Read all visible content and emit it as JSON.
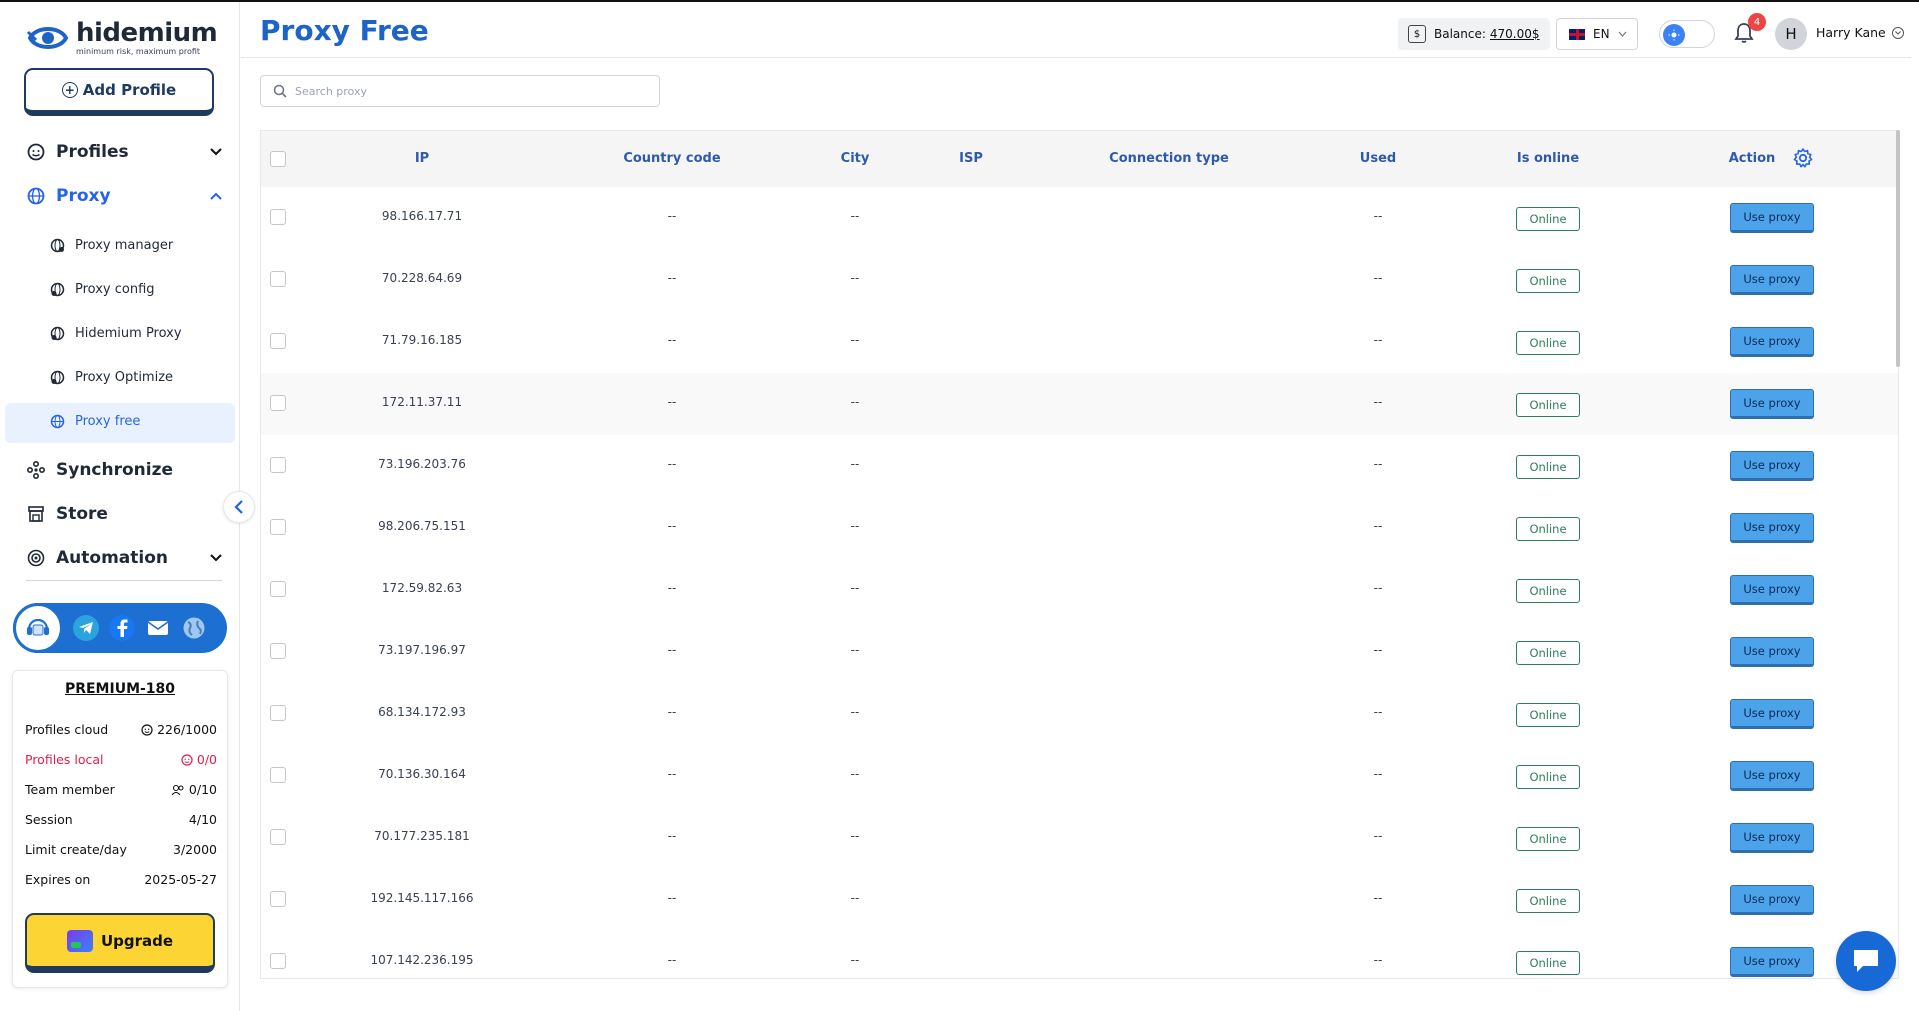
{
  "app": {
    "logo_name": "hidemium",
    "logo_tagline": "minimum risk, maximum profit"
  },
  "sidebar": {
    "add_profile_label": "Add Profile",
    "items": [
      {
        "label": "Profiles",
        "icon": "profiles-icon"
      },
      {
        "label": "Proxy",
        "icon": "globe-icon"
      },
      {
        "label": "Synchronize",
        "icon": "sync-icon"
      },
      {
        "label": "Store",
        "icon": "store-icon"
      },
      {
        "label": "Automation",
        "icon": "automation-icon"
      }
    ],
    "proxy_subitems": [
      {
        "label": "Proxy manager"
      },
      {
        "label": "Proxy config"
      },
      {
        "label": "Hidemium Proxy"
      },
      {
        "label": "Proxy Optimize"
      },
      {
        "label": "Proxy free"
      }
    ],
    "social_icons": [
      "support-agent-icon",
      "telegram-icon",
      "facebook-icon",
      "mail-icon",
      "globe-icon"
    ]
  },
  "plan": {
    "name": "PREMIUM-180",
    "rows": [
      {
        "label": "Profiles cloud",
        "value": "226/1000"
      },
      {
        "label": "Profiles local",
        "value": "0/0"
      },
      {
        "label": "Team member",
        "value": "0/10"
      },
      {
        "label": "Session",
        "value": "4/10"
      },
      {
        "label": "Limit create/day",
        "value": "3/2000"
      },
      {
        "label": "Expires on",
        "value": "2025-05-27"
      }
    ],
    "upgrade_label": "Upgrade"
  },
  "header": {
    "title": "Proxy Free",
    "balance_label": "Balance:",
    "balance_value": "470.00$",
    "language": "EN",
    "notification_count": "4",
    "avatar_initial": "H",
    "user_name": "Harry Kane"
  },
  "search": {
    "placeholder": "Search proxy",
    "value": ""
  },
  "table": {
    "columns": [
      "IP",
      "Country code",
      "City",
      "ISP",
      "Connection type",
      "Used",
      "Is online",
      "Action"
    ],
    "rows": [
      {
        "ip": "98.166.17.71",
        "country": "--",
        "city": "--",
        "used": "--",
        "status": "Online",
        "action": "Use proxy"
      },
      {
        "ip": "70.228.64.69",
        "country": "--",
        "city": "--",
        "used": "--",
        "status": "Online",
        "action": "Use proxy"
      },
      {
        "ip": "71.79.16.185",
        "country": "--",
        "city": "--",
        "used": "--",
        "status": "Online",
        "action": "Use proxy"
      },
      {
        "ip": "172.11.37.11",
        "country": "--",
        "city": "--",
        "used": "--",
        "status": "Online",
        "action": "Use proxy"
      },
      {
        "ip": "73.196.203.76",
        "country": "--",
        "city": "--",
        "used": "--",
        "status": "Online",
        "action": "Use proxy"
      },
      {
        "ip": "98.206.75.151",
        "country": "--",
        "city": "--",
        "used": "--",
        "status": "Online",
        "action": "Use proxy"
      },
      {
        "ip": "172.59.82.63",
        "country": "--",
        "city": "--",
        "used": "--",
        "status": "Online",
        "action": "Use proxy"
      },
      {
        "ip": "73.197.196.97",
        "country": "--",
        "city": "--",
        "used": "--",
        "status": "Online",
        "action": "Use proxy"
      },
      {
        "ip": "68.134.172.93",
        "country": "--",
        "city": "--",
        "used": "--",
        "status": "Online",
        "action": "Use proxy"
      },
      {
        "ip": "70.136.30.164",
        "country": "--",
        "city": "--",
        "used": "--",
        "status": "Online",
        "action": "Use proxy"
      },
      {
        "ip": "70.177.235.181",
        "country": "--",
        "city": "--",
        "used": "--",
        "status": "Online",
        "action": "Use proxy"
      },
      {
        "ip": "192.145.117.166",
        "country": "--",
        "city": "--",
        "used": "--",
        "status": "Online",
        "action": "Use proxy"
      },
      {
        "ip": "107.142.236.195",
        "country": "--",
        "city": "--",
        "used": "--",
        "status": "Online",
        "action": "Use proxy"
      }
    ]
  },
  "colors": {
    "accent": "#2563eb",
    "title_blue": "#1d63c8",
    "online_green": "#2e7d5b",
    "use_proxy_bg": "#4da3ea",
    "upgrade_yellow": "#fcd535",
    "danger_red": "#e11d48"
  }
}
